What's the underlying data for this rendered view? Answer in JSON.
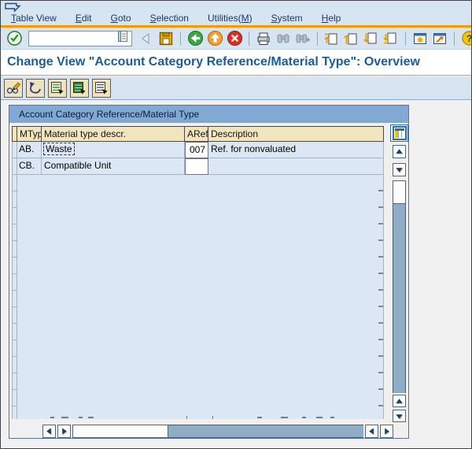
{
  "screen_title": "Change View \"Account Category Reference/Material Type\": Overview",
  "menu_bar": {
    "items": [
      {
        "label": "Table View",
        "underline": 0
      },
      {
        "label": "Edit",
        "underline": 0
      },
      {
        "label": "Goto",
        "underline": 0
      },
      {
        "label": "Selection",
        "underline": 0
      },
      {
        "label": "Utilities(M)",
        "underline": 10
      },
      {
        "label": "System",
        "underline": 0
      },
      {
        "label": "Help",
        "underline": 0
      }
    ]
  },
  "toolbar": {
    "command_field": {
      "value": "",
      "placeholder": ""
    },
    "icons": [
      "enter-check",
      "command-list",
      "hide-command",
      "save",
      "back",
      "exit",
      "cancel",
      "print",
      "find",
      "find-next",
      "first-page",
      "page-up",
      "page-down",
      "last-page",
      "new-session",
      "create-shortcut",
      "help",
      "customize-layout"
    ]
  },
  "app_toolbar": {
    "icons": [
      "display-change-toggle",
      "undo",
      "select-all",
      "select-block",
      "deselect-all"
    ]
  },
  "table": {
    "title": "Account Category Reference/Material Type",
    "columns": [
      {
        "label": "MTyp"
      },
      {
        "label": "Material type descr."
      },
      {
        "label": "ARef"
      },
      {
        "label": "Description"
      }
    ],
    "rows": [
      {
        "mtyp": "AB.",
        "material_type_descr": "Waste",
        "aref": "007",
        "description": "Ref. for nonvaluated",
        "cell_focused": true
      },
      {
        "mtyp": "CB.",
        "material_type_descr": "Compatible Unit",
        "aref": "",
        "description": "",
        "cell_focused": false
      }
    ]
  },
  "colors": {
    "accent_orange": "#F49B00",
    "bar_blue": "#D7E4F2",
    "title_text_blue": "#1D5C99",
    "table_title_blue": "#81A9D3",
    "header_beige": "#F2E4BD",
    "row_blue": "#DBE7F5",
    "scroll_track": "#8FAEC6"
  }
}
